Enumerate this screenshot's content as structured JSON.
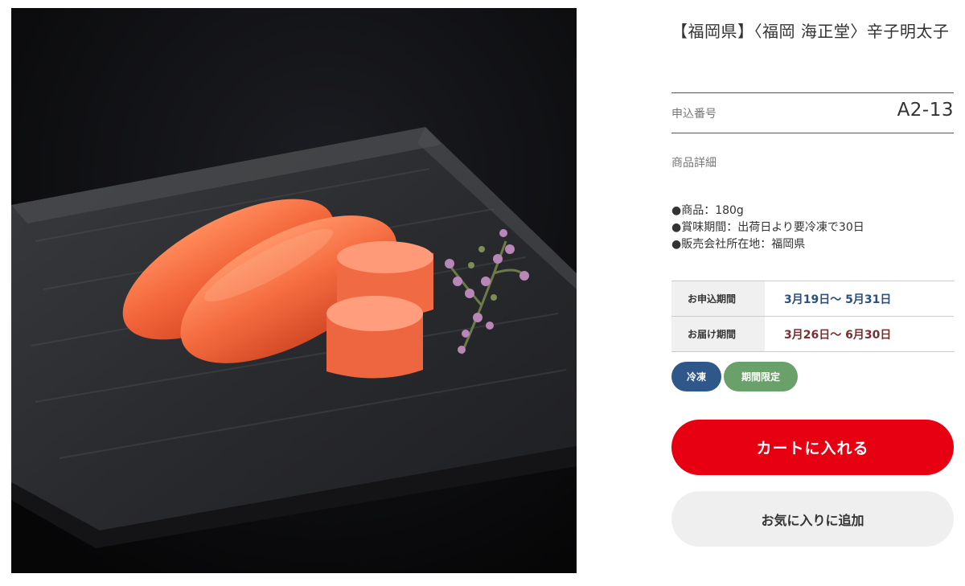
{
  "product": {
    "image_alt": "辛子明太子",
    "title": "【福岡県】〈福岡 海正堂〉辛子明太子",
    "code_label": "申込番号",
    "code_value": "A2-13",
    "details_label": "商品詳細",
    "details": [
      "●商品：180g",
      "●賞味期間：出荷日より要冷凍で30日",
      "●販売会社所在地：福岡県"
    ],
    "periods": [
      {
        "label": "お申込期間",
        "value": "3月19日～ 5月31日",
        "color": "#2d4f7c"
      },
      {
        "label": "お届け期間",
        "value": "3月26日～ 6月30日",
        "color": "#7a2f2f"
      }
    ],
    "tags": [
      {
        "label": "冷凍",
        "color": "#2f578a"
      },
      {
        "label": "期間限定",
        "color": "#6aa06a"
      }
    ],
    "cart_button": "カートに入れる",
    "favorite_button": "お気に入りに追加"
  },
  "colors": {
    "cart": "#e60012",
    "favorite": "#efefef",
    "photo_background": "#0c0c0e"
  }
}
